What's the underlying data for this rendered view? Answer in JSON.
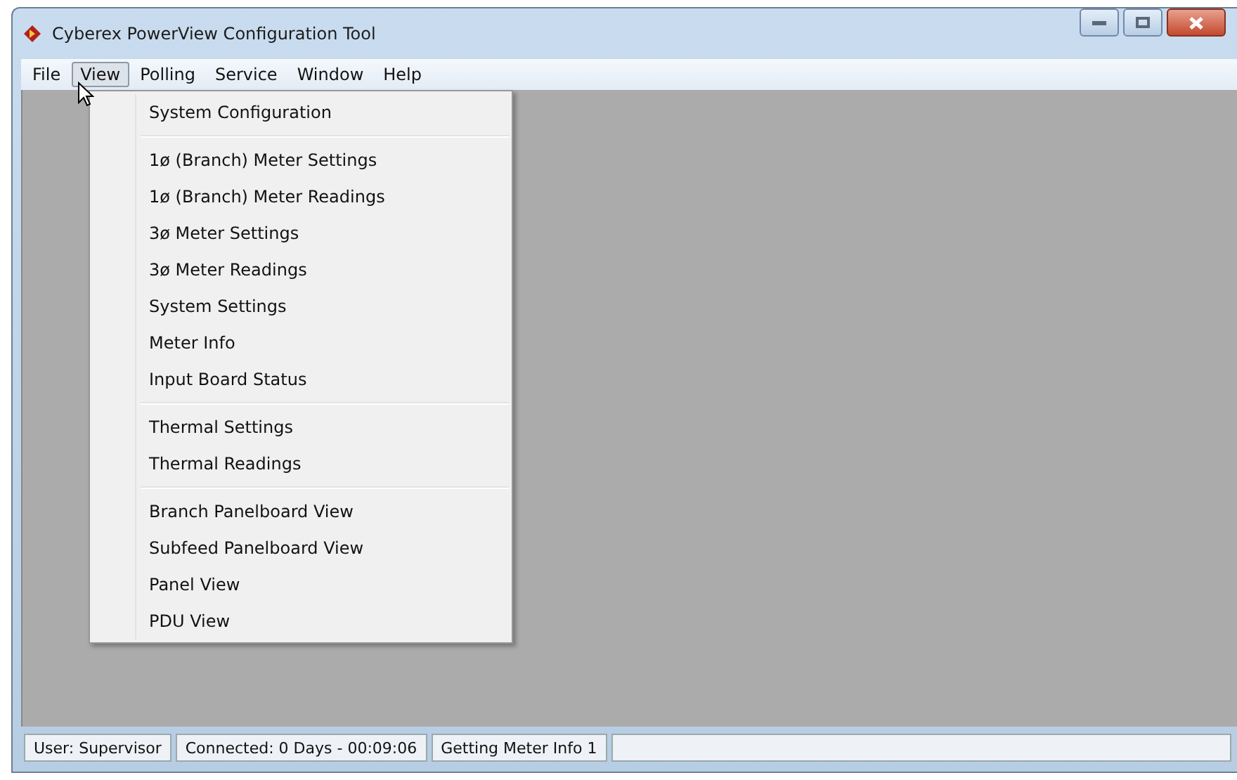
{
  "window": {
    "title": "Cyberex PowerView Configuration Tool"
  },
  "menu_bar": [
    {
      "label": "File",
      "selected": false
    },
    {
      "label": "View",
      "selected": true
    },
    {
      "label": "Polling",
      "selected": false
    },
    {
      "label": "Service",
      "selected": false
    },
    {
      "label": "Window",
      "selected": false
    },
    {
      "label": "Help",
      "selected": false
    }
  ],
  "dropdown": {
    "groups": [
      {
        "items": [
          "System Configuration"
        ]
      },
      {
        "items": [
          "1ø (Branch) Meter Settings",
          "1ø (Branch) Meter Readings",
          "3ø Meter Settings",
          "3ø Meter Readings",
          "System Settings",
          "Meter Info",
          "Input Board Status"
        ]
      },
      {
        "items": [
          "Thermal Settings",
          "Thermal Readings"
        ]
      },
      {
        "items": [
          "Branch Panelboard View",
          "Subfeed Panelboard View",
          "Panel View",
          "PDU View"
        ]
      }
    ]
  },
  "status_bar": [
    "User: Supervisor",
    "Connected: 0 Days - 00:09:06",
    "Getting Meter Info 1"
  ]
}
